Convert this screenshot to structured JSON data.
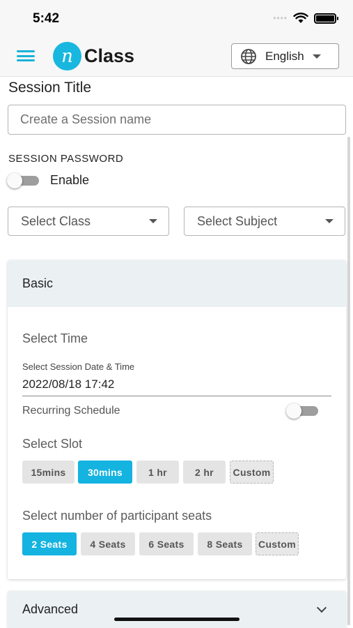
{
  "status_bar": {
    "time": "5:42",
    "icons": [
      "signal-dots-icon",
      "wifi-icon",
      "battery-icon"
    ]
  },
  "header": {
    "menu_icon": "hamburger-menu-icon",
    "logo_mark": "n",
    "logo_text": "Class",
    "language": {
      "icon": "globe-icon",
      "selected": "English"
    }
  },
  "session": {
    "title_label": "Session Title",
    "title_placeholder": "Create a Session name",
    "password_label": "SESSION PASSWORD",
    "enable_label": "Enable",
    "password_enabled": false
  },
  "selects": {
    "class_placeholder": "Select Class",
    "subject_placeholder": "Select Subject"
  },
  "basic": {
    "header": "Basic",
    "select_time_label": "Select Time",
    "datetime_label": "Select Session Date & Time",
    "datetime_value": "2022/08/18 17:42",
    "recurring_label": "Recurring Schedule",
    "recurring_enabled": false,
    "slot_label": "Select Slot",
    "slots": [
      "15mins",
      "30mins",
      "1 hr",
      "2 hr",
      "Custom"
    ],
    "selected_slot": "30mins",
    "seats_label": "Select number of participant seats",
    "seats": [
      "2 Seats",
      "4 Seats",
      "6 Seats",
      "8 Seats",
      "Custom"
    ],
    "selected_seats": "2 Seats"
  },
  "advanced": {
    "header": "Advanced",
    "icon": "chevron-down-icon"
  },
  "colors": {
    "accent": "#14b3e0",
    "section_bg": "#ebf0f3",
    "chip_bg": "#e4e4e4"
  }
}
